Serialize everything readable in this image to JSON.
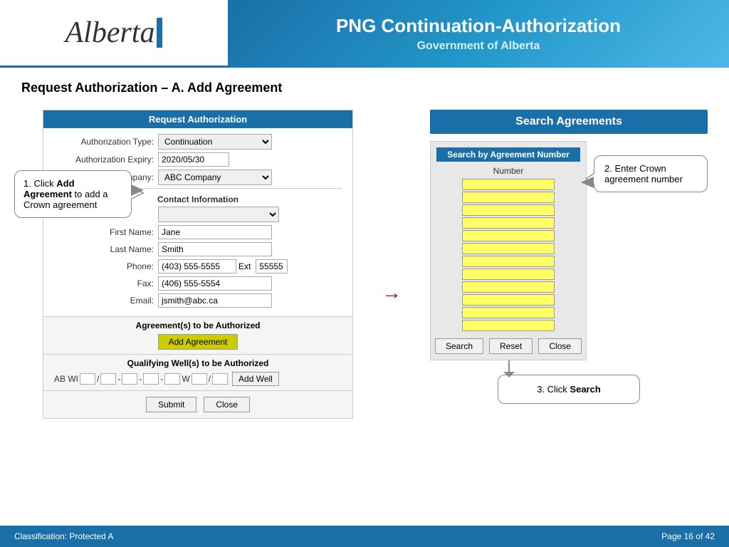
{
  "header": {
    "main_title": "PNG Continuation-Authorization",
    "sub_title": "Government of Alberta",
    "logo_text": "Alberta"
  },
  "page_title": "Request Authorization – A. Add Agreement",
  "form": {
    "header": "Request Authorization",
    "auth_type_label": "Authorization Type:",
    "auth_type_value": "Continuation",
    "auth_expiry_label": "Authorization Expiry:",
    "auth_expiry_value": "2020/05/30",
    "req_company_label": "Requesting Company:",
    "req_company_value": "ABC Company",
    "contact_info_header": "Contact Information",
    "first_name_label": "First Name:",
    "first_name_value": "Jane",
    "last_name_label": "Last Name:",
    "last_name_value": "Smith",
    "phone_label": "Phone:",
    "phone_value": "(403) 555-5555",
    "ext_label": "Ext",
    "ext_value": "55555",
    "fax_label": "Fax:",
    "fax_value": "(406) 555-5554",
    "email_label": "Email:",
    "email_value": "jsmith@abc.ca",
    "agreements_header": "Agreement(s) to be Authorized",
    "add_agreement_btn": "Add Agreement",
    "wells_header": "Qualifying Well(s) to be Authorized",
    "ab_wi_label": "AB WI",
    "add_well_btn": "Add Well",
    "submit_btn": "Submit",
    "close_btn": "Close"
  },
  "callout1": {
    "text_prefix": "1.  Click ",
    "text_bold": "Add Agreement",
    "text_suffix": "  to add a Crown agreement"
  },
  "search_panel": {
    "header": "Search Agreements",
    "search_by_header": "Search by Agreement Number",
    "number_label": "Number",
    "search_btn": "Search",
    "reset_btn": "Reset",
    "close_btn": "Close",
    "num_rows": 12
  },
  "callout2": {
    "text": "2. Enter Crown agreement number"
  },
  "callout3": {
    "text_prefix": "3. Click ",
    "text_bold": "Search"
  },
  "footer": {
    "classification": "Classification: Protected A",
    "page": "Page 16 of 42"
  }
}
